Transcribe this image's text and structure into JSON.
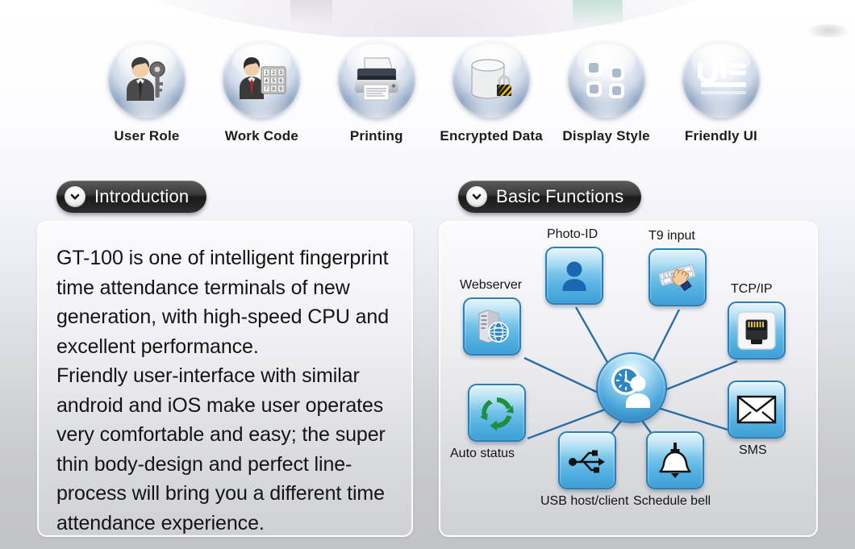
{
  "features": [
    {
      "label": "User Role",
      "icon": "user-key-icon"
    },
    {
      "label": "Work Code",
      "icon": "user-keypad-icon"
    },
    {
      "label": "Printing",
      "icon": "printer-icon"
    },
    {
      "label": "Encrypted Data",
      "icon": "database-lock-icon"
    },
    {
      "label": "Display Style",
      "icon": "four-squares-icon"
    },
    {
      "label": "Friendly UI",
      "icon": "ui-lines-icon"
    }
  ],
  "sections": {
    "introduction": {
      "title": "Introduction",
      "chevron": "chevron-down-icon",
      "body": "GT-100 is one of intelligent fingerprint time attendance terminals of new generation, with high-speed CPU and excellent performance.\nFriendly user-interface with similar android and iOS make user operates very comfortable and easy; the super thin body-design and perfect line-process will bring you a different time attendance experience."
    },
    "basic_functions": {
      "title": "Basic Functions",
      "chevron": "chevron-down-icon",
      "hub": {
        "name": "time-attendance-hub",
        "icon": "clock-person-icon"
      },
      "nodes": [
        {
          "label": "Photo-ID",
          "icon": "person-portrait-icon"
        },
        {
          "label": "T9 input",
          "icon": "hand-keyboard-icon"
        },
        {
          "label": "Webserver",
          "icon": "server-globe-icon"
        },
        {
          "label": "TCP/IP",
          "icon": "ethernet-port-icon"
        },
        {
          "label": "Auto status",
          "icon": "recycle-arrows-icon"
        },
        {
          "label": "SMS",
          "icon": "envelope-icon"
        },
        {
          "label": "USB host/client",
          "icon": "usb-icon"
        },
        {
          "label": "Schedule bell",
          "icon": "bell-icon"
        }
      ]
    }
  },
  "colors": {
    "tile_blue": "#55b2e2",
    "tile_border": "#2a7fb8",
    "link_line": "#2a6ea8",
    "pill_dark": "#1a1a1a",
    "text_dark": "#141414"
  }
}
